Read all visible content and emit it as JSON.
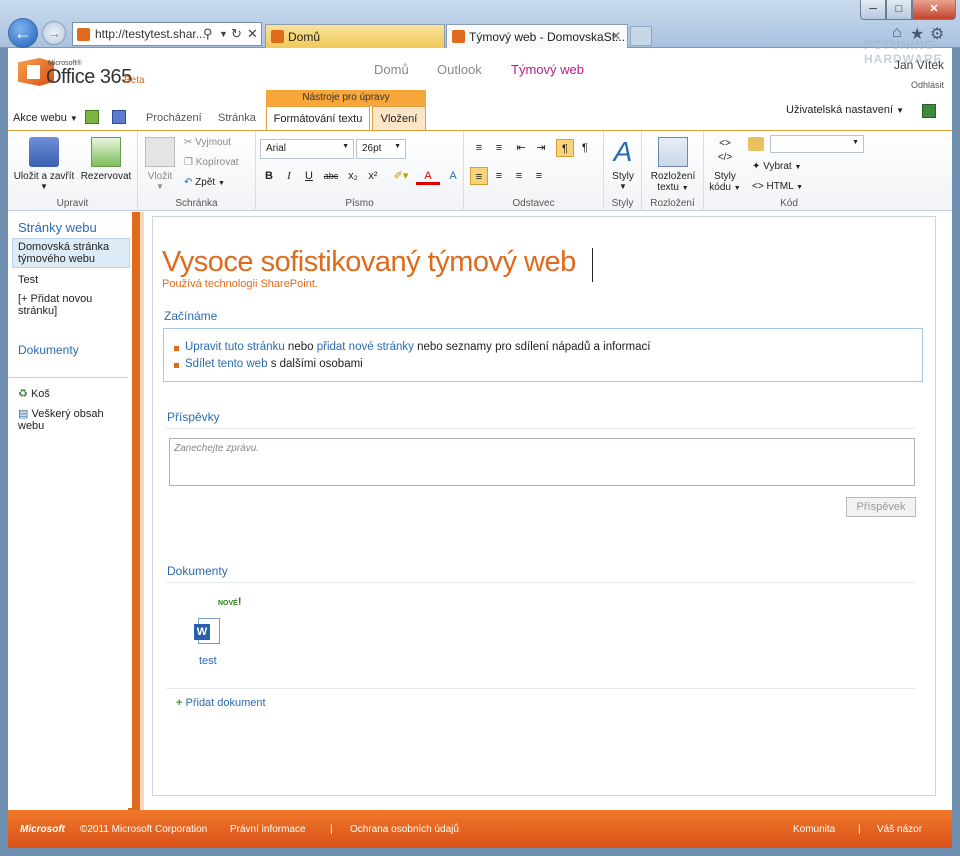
{
  "browser": {
    "address": "http://testytest.shar...",
    "tabs": [
      {
        "label": "Domů"
      },
      {
        "label": "Týmový web - DomovskaSt..."
      }
    ],
    "window": {
      "minimize": "─",
      "maximize": "□",
      "close": "✕"
    }
  },
  "header": {
    "logo_small": "Microsoft®",
    "logo_main": "Office 365",
    "logo_beta": "Beta",
    "nav": [
      "Domů",
      "Outlook",
      "Týmový web"
    ],
    "user_name": "Jan Vítek",
    "signout": "Odhlásit",
    "watermark": "PCTUNING HARDWARE"
  },
  "ribbon_tabs": {
    "site_actions": "Akce webu",
    "browse": "Procházení",
    "page": "Stránka",
    "context_group": "Nástroje pro úpravy",
    "format_text": "Formátování textu",
    "insert": "Vložení",
    "user_settings": "Uživatelská nastavení"
  },
  "ribbon": {
    "edit": {
      "save": "Uložit a zavřít",
      "checkout": "Rezervovat",
      "label": "Upravit"
    },
    "clipboard": {
      "paste": "Vložit",
      "cut": "Vyjmout",
      "copy": "Kopírovat",
      "undo": "Zpět",
      "label": "Schránka"
    },
    "font": {
      "family": "Arial",
      "size": "26pt",
      "label": "Písmo",
      "bold": "B",
      "italic": "I",
      "underline": "U",
      "strike": "abc",
      "sub": "x₂",
      "sup": "x²"
    },
    "paragraph": {
      "label": "Odstavec"
    },
    "styles": {
      "button": "Styly",
      "label": "Styly"
    },
    "layout": {
      "button_line1": "Rozložení",
      "button_line2": "textu",
      "label": "Rozložení"
    },
    "code": {
      "styles_line1": "Styly",
      "styles_line2": "kódu",
      "select": "Vybrat",
      "html": "HTML",
      "label": "Kód"
    }
  },
  "sidebar": {
    "heading_pages": "Stránky webu",
    "items": [
      {
        "line1": "Domovská stránka",
        "line2": "týmového webu"
      },
      {
        "line1": "Test"
      },
      {
        "line1": "[+ Přidat novou",
        "line2": "stránku]"
      }
    ],
    "heading_docs": "Dokumenty",
    "recycle": "Koš",
    "all_content_line1": "Veškerý obsah",
    "all_content_line2": "webu"
  },
  "main": {
    "title": "Vysoce sofistikovaný týmový web",
    "subtitle": "Používá technologii SharePoint.",
    "getting_started": "Začínáme",
    "list": [
      {
        "link1": "Upravit tuto stránku",
        "text1": "nebo",
        "link2": "přidat nové stránky",
        "text2": "nebo seznamy pro sdílení nápadů a informací"
      },
      {
        "link1": "Sdílet tento web",
        "text1": "s dalšími osobami"
      }
    ],
    "posts_heading": "Příspěvky",
    "message_placeholder": "Zanechejte zprávu.",
    "post_button": "Příspěvek",
    "docs_heading": "Dokumenty",
    "new_badge": "NOVÉ",
    "doc_name": "test",
    "add_doc": "Přidat dokument"
  },
  "footer": {
    "brand": "Microsoft",
    "copyright": "©2011 Microsoft Corporation",
    "legal": "Právní informace",
    "privacy": "Ochrana osobních údajů",
    "community": "Komunita",
    "feedback": "Váš názor"
  },
  "colors": {
    "accent": "#e06a1b",
    "link": "#2a6bb0",
    "nav_active": "#c0188c"
  }
}
